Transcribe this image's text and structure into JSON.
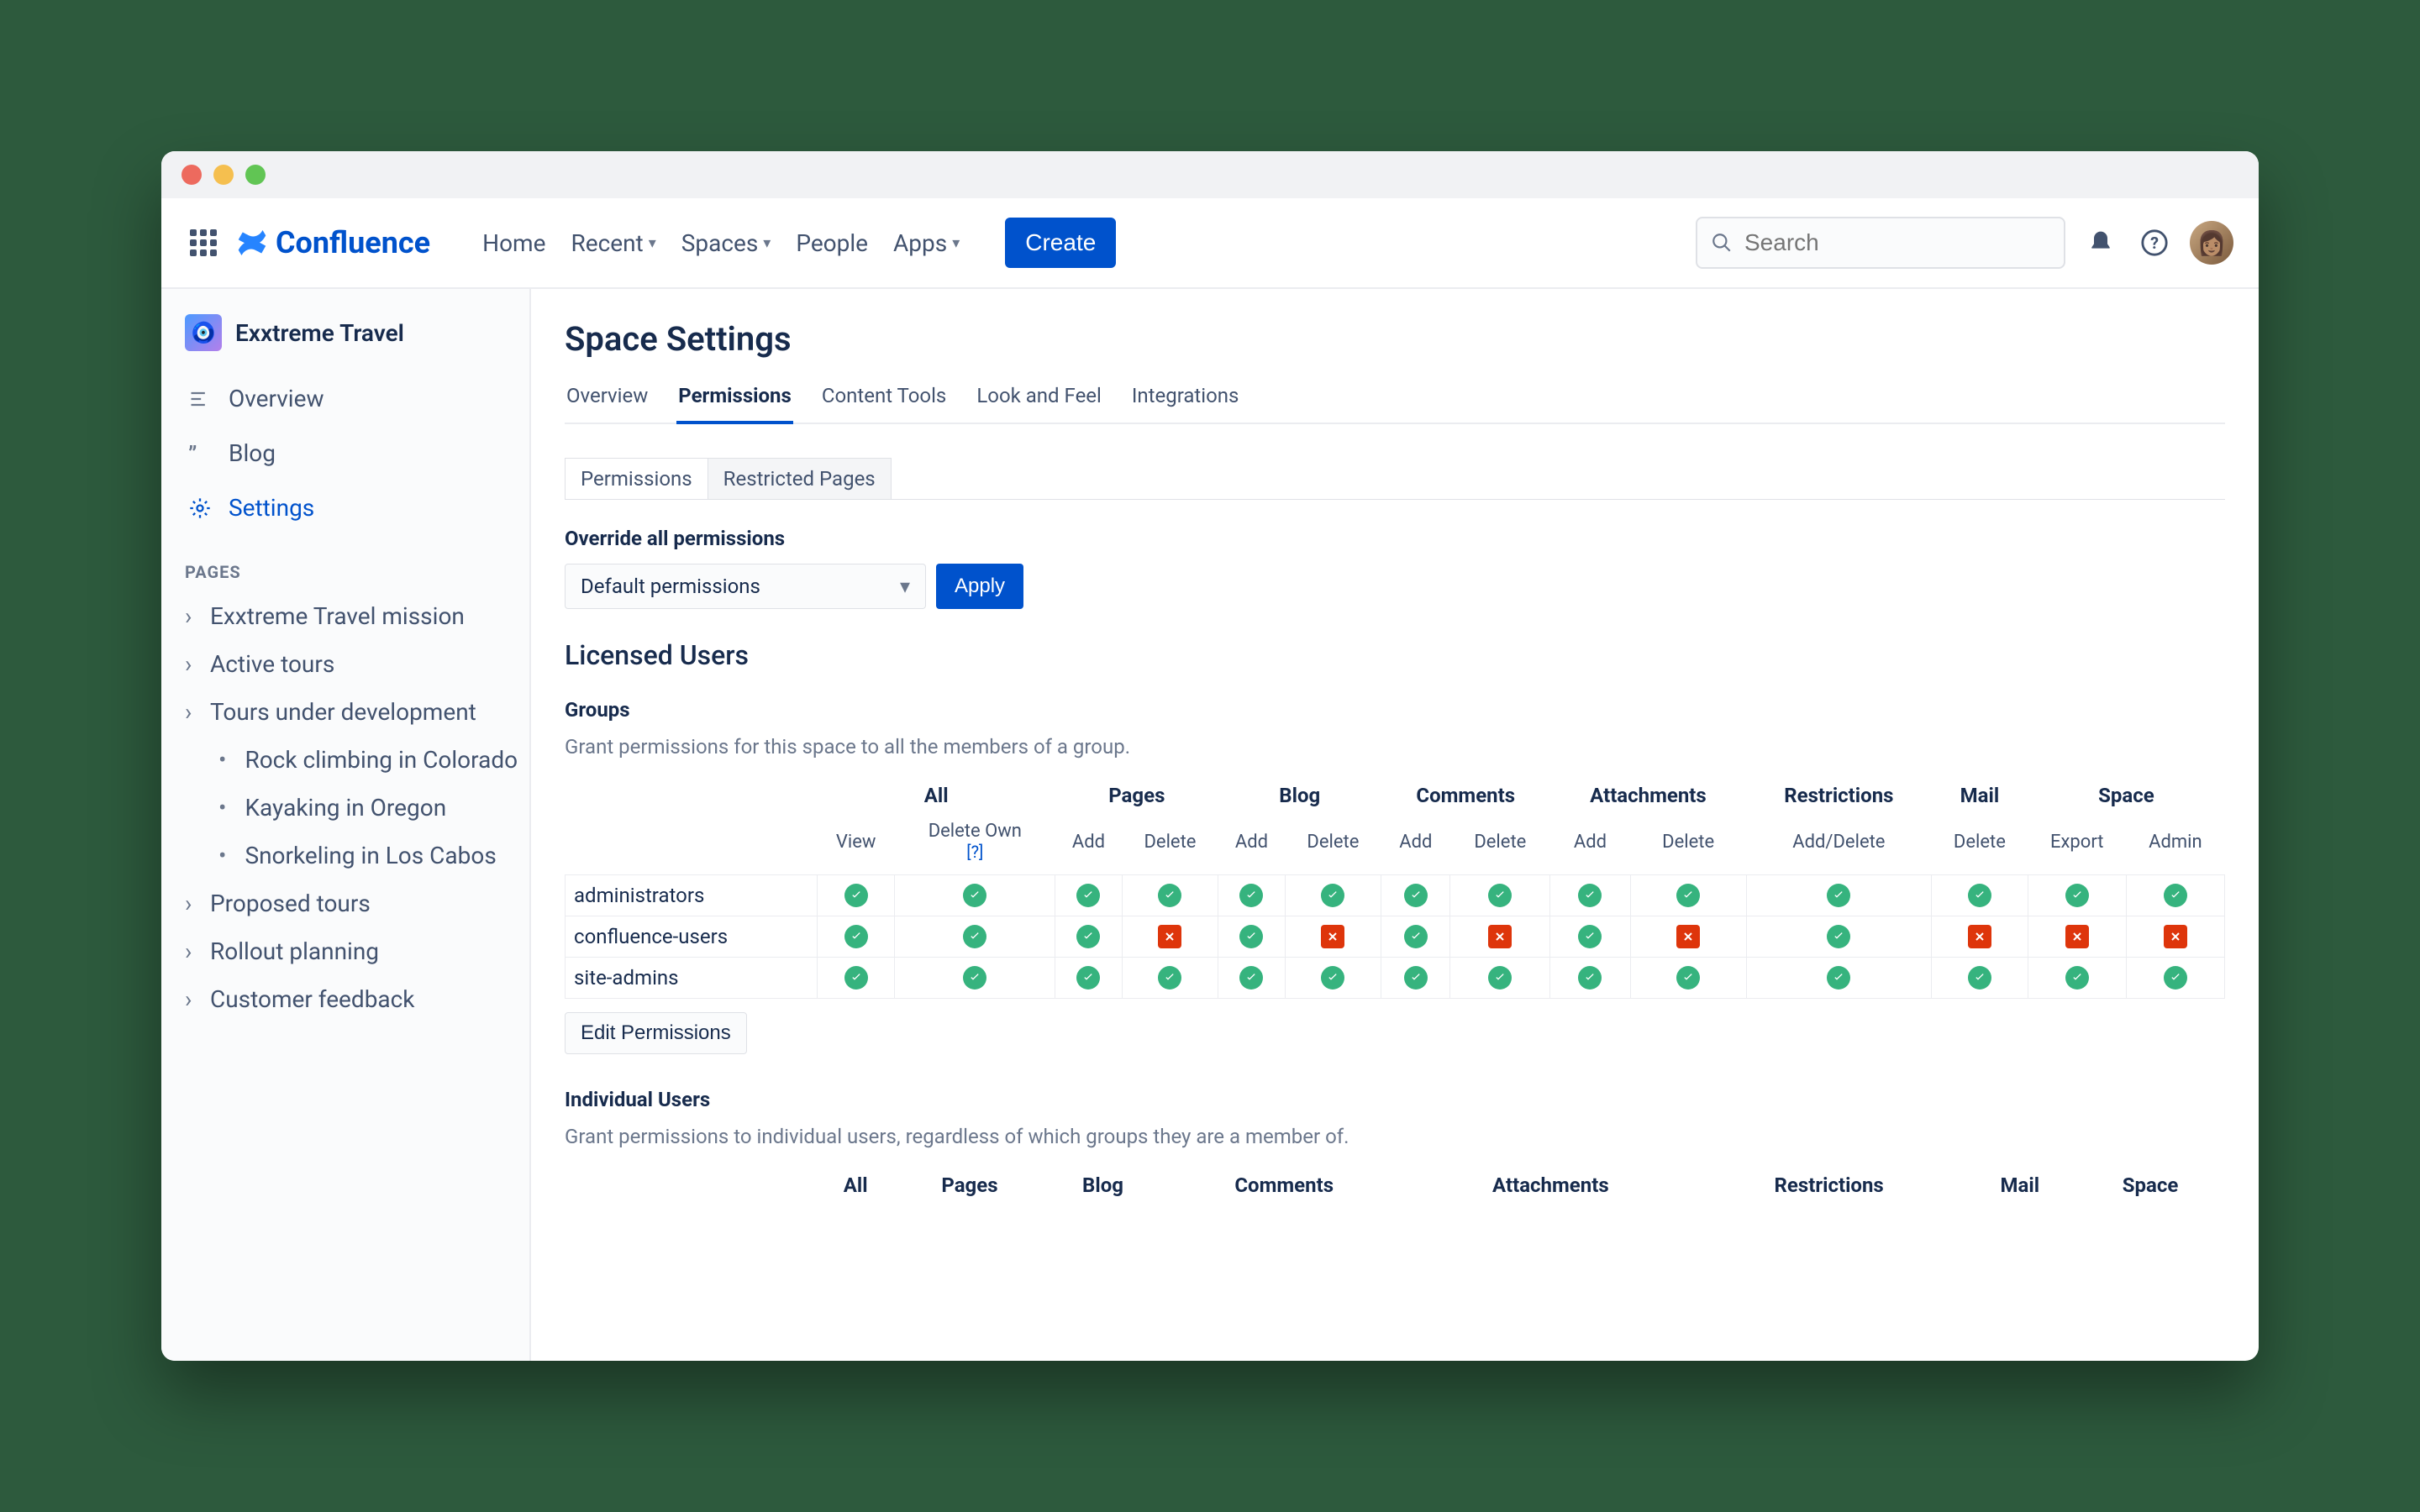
{
  "appBrand": "Confluence",
  "nav": {
    "home": "Home",
    "recent": "Recent",
    "spaces": "Spaces",
    "people": "People",
    "apps": "Apps",
    "create": "Create",
    "searchPlaceholder": "Search"
  },
  "sidebar": {
    "spaceName": "Exxtreme Travel",
    "overview": "Overview",
    "blog": "Blog",
    "settings": "Settings",
    "pagesLabel": "PAGES",
    "pages": [
      "Exxtreme Travel mission",
      "Active tours",
      "Tours under development",
      "Proposed tours",
      "Rollout planning",
      "Customer feedback"
    ],
    "subpages": [
      "Rock climbing in Colorado",
      "Kayaking in Oregon",
      "Snorkeling in Los Cabos"
    ]
  },
  "main": {
    "title": "Space Settings",
    "tabs": [
      "Overview",
      "Permissions",
      "Content Tools",
      "Look and Feel",
      "Integrations"
    ],
    "subtabs": [
      "Permissions",
      "Restricted Pages"
    ],
    "overrideTitle": "Override all permissions",
    "overrideOption": "Default permissions",
    "applyLabel": "Apply",
    "licensedUsers": "Licensed Users",
    "groupsHeading": "Groups",
    "groupsDesc": "Grant permissions for this space to all the members of a group.",
    "colGroups": [
      "All",
      "Pages",
      "Blog",
      "Comments",
      "Attachments",
      "Restrictions",
      "Mail",
      "Space"
    ],
    "subCols": [
      "View",
      "Delete Own",
      "Add",
      "Delete",
      "Add",
      "Delete",
      "Add",
      "Delete",
      "Add",
      "Delete",
      "Add/Delete",
      "Delete",
      "Export",
      "Admin"
    ],
    "helpTag": "[?]",
    "groups": [
      {
        "name": "administrators",
        "perms": [
          1,
          1,
          1,
          1,
          1,
          1,
          1,
          1,
          1,
          1,
          1,
          1,
          1,
          1
        ]
      },
      {
        "name": "confluence-users",
        "perms": [
          1,
          1,
          1,
          0,
          1,
          0,
          1,
          0,
          1,
          0,
          1,
          0,
          0,
          0
        ]
      },
      {
        "name": "site-admins",
        "perms": [
          1,
          1,
          1,
          1,
          1,
          1,
          1,
          1,
          1,
          1,
          1,
          1,
          1,
          1
        ]
      }
    ],
    "editPermissions": "Edit Permissions",
    "indivHeading": "Individual Users",
    "indivDesc": "Grant permissions to individual users, regardless of which groups they are a member of."
  }
}
